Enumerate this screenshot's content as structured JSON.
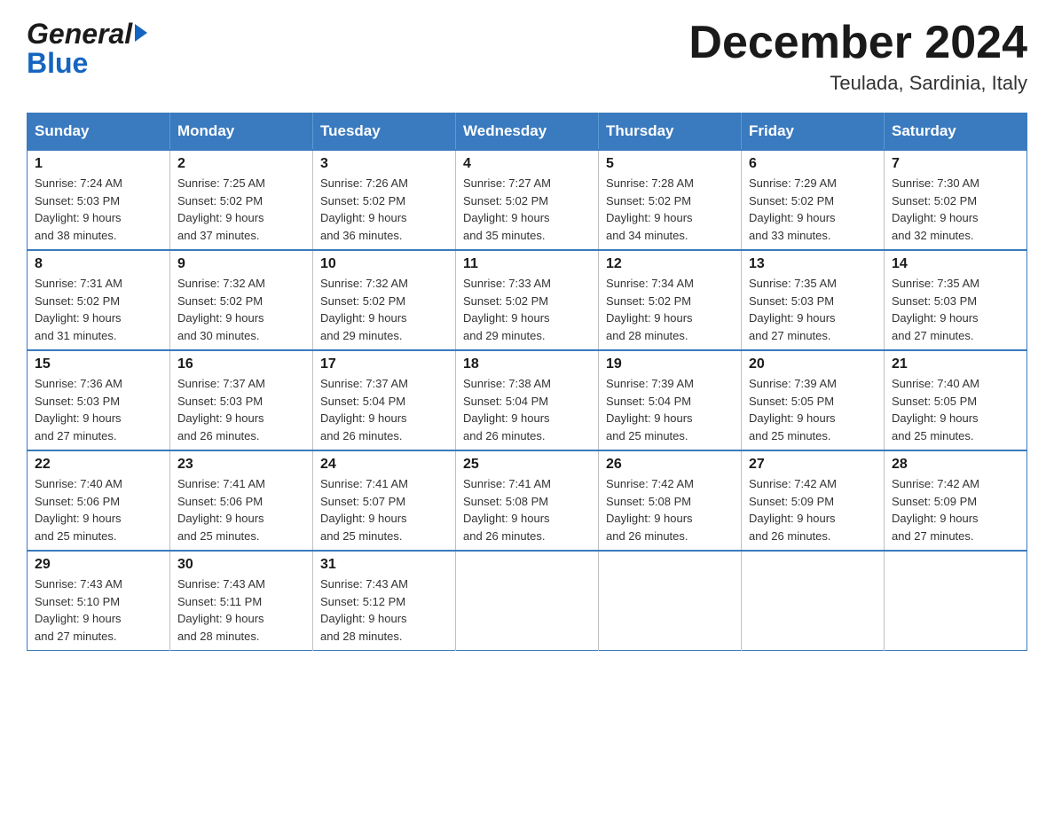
{
  "header": {
    "logo_general": "General",
    "logo_blue": "Blue",
    "month_title": "December 2024",
    "location": "Teulada, Sardinia, Italy"
  },
  "days_of_week": [
    "Sunday",
    "Monday",
    "Tuesday",
    "Wednesday",
    "Thursday",
    "Friday",
    "Saturday"
  ],
  "weeks": [
    [
      {
        "day": "1",
        "sunrise": "7:24 AM",
        "sunset": "5:03 PM",
        "daylight": "9 hours and 38 minutes."
      },
      {
        "day": "2",
        "sunrise": "7:25 AM",
        "sunset": "5:02 PM",
        "daylight": "9 hours and 37 minutes."
      },
      {
        "day": "3",
        "sunrise": "7:26 AM",
        "sunset": "5:02 PM",
        "daylight": "9 hours and 36 minutes."
      },
      {
        "day": "4",
        "sunrise": "7:27 AM",
        "sunset": "5:02 PM",
        "daylight": "9 hours and 35 minutes."
      },
      {
        "day": "5",
        "sunrise": "7:28 AM",
        "sunset": "5:02 PM",
        "daylight": "9 hours and 34 minutes."
      },
      {
        "day": "6",
        "sunrise": "7:29 AM",
        "sunset": "5:02 PM",
        "daylight": "9 hours and 33 minutes."
      },
      {
        "day": "7",
        "sunrise": "7:30 AM",
        "sunset": "5:02 PM",
        "daylight": "9 hours and 32 minutes."
      }
    ],
    [
      {
        "day": "8",
        "sunrise": "7:31 AM",
        "sunset": "5:02 PM",
        "daylight": "9 hours and 31 minutes."
      },
      {
        "day": "9",
        "sunrise": "7:32 AM",
        "sunset": "5:02 PM",
        "daylight": "9 hours and 30 minutes."
      },
      {
        "day": "10",
        "sunrise": "7:32 AM",
        "sunset": "5:02 PM",
        "daylight": "9 hours and 29 minutes."
      },
      {
        "day": "11",
        "sunrise": "7:33 AM",
        "sunset": "5:02 PM",
        "daylight": "9 hours and 29 minutes."
      },
      {
        "day": "12",
        "sunrise": "7:34 AM",
        "sunset": "5:02 PM",
        "daylight": "9 hours and 28 minutes."
      },
      {
        "day": "13",
        "sunrise": "7:35 AM",
        "sunset": "5:03 PM",
        "daylight": "9 hours and 27 minutes."
      },
      {
        "day": "14",
        "sunrise": "7:35 AM",
        "sunset": "5:03 PM",
        "daylight": "9 hours and 27 minutes."
      }
    ],
    [
      {
        "day": "15",
        "sunrise": "7:36 AM",
        "sunset": "5:03 PM",
        "daylight": "9 hours and 27 minutes."
      },
      {
        "day": "16",
        "sunrise": "7:37 AM",
        "sunset": "5:03 PM",
        "daylight": "9 hours and 26 minutes."
      },
      {
        "day": "17",
        "sunrise": "7:37 AM",
        "sunset": "5:04 PM",
        "daylight": "9 hours and 26 minutes."
      },
      {
        "day": "18",
        "sunrise": "7:38 AM",
        "sunset": "5:04 PM",
        "daylight": "9 hours and 26 minutes."
      },
      {
        "day": "19",
        "sunrise": "7:39 AM",
        "sunset": "5:04 PM",
        "daylight": "9 hours and 25 minutes."
      },
      {
        "day": "20",
        "sunrise": "7:39 AM",
        "sunset": "5:05 PM",
        "daylight": "9 hours and 25 minutes."
      },
      {
        "day": "21",
        "sunrise": "7:40 AM",
        "sunset": "5:05 PM",
        "daylight": "9 hours and 25 minutes."
      }
    ],
    [
      {
        "day": "22",
        "sunrise": "7:40 AM",
        "sunset": "5:06 PM",
        "daylight": "9 hours and 25 minutes."
      },
      {
        "day": "23",
        "sunrise": "7:41 AM",
        "sunset": "5:06 PM",
        "daylight": "9 hours and 25 minutes."
      },
      {
        "day": "24",
        "sunrise": "7:41 AM",
        "sunset": "5:07 PM",
        "daylight": "9 hours and 25 minutes."
      },
      {
        "day": "25",
        "sunrise": "7:41 AM",
        "sunset": "5:08 PM",
        "daylight": "9 hours and 26 minutes."
      },
      {
        "day": "26",
        "sunrise": "7:42 AM",
        "sunset": "5:08 PM",
        "daylight": "9 hours and 26 minutes."
      },
      {
        "day": "27",
        "sunrise": "7:42 AM",
        "sunset": "5:09 PM",
        "daylight": "9 hours and 26 minutes."
      },
      {
        "day": "28",
        "sunrise": "7:42 AM",
        "sunset": "5:09 PM",
        "daylight": "9 hours and 27 minutes."
      }
    ],
    [
      {
        "day": "29",
        "sunrise": "7:43 AM",
        "sunset": "5:10 PM",
        "daylight": "9 hours and 27 minutes."
      },
      {
        "day": "30",
        "sunrise": "7:43 AM",
        "sunset": "5:11 PM",
        "daylight": "9 hours and 28 minutes."
      },
      {
        "day": "31",
        "sunrise": "7:43 AM",
        "sunset": "5:12 PM",
        "daylight": "9 hours and 28 minutes."
      },
      null,
      null,
      null,
      null
    ]
  ],
  "labels": {
    "sunrise": "Sunrise:",
    "sunset": "Sunset:",
    "daylight": "Daylight:"
  }
}
